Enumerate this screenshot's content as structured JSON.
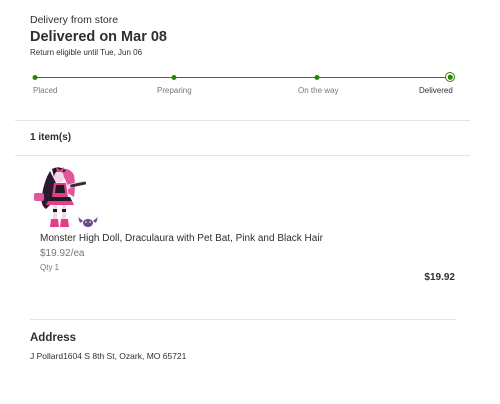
{
  "order": {
    "delivery_method": "Delivery from store",
    "status_title": "Delivered on Mar 08",
    "return_note": "Return eligible until Tue, Jun 06"
  },
  "tracker": {
    "steps": [
      "Placed",
      "Preparing",
      "On the way",
      "Delivered"
    ],
    "current_step": "Delivered",
    "accent_color": "#2a8703"
  },
  "items": {
    "count_label": "1 item(s)",
    "list": [
      {
        "image_icon": "doll-product-image",
        "name": "Monster High Doll, Draculaura with Pet Bat, Pink and Black Hair",
        "unit_price": "$19.92/ea",
        "qty": "Qty 1",
        "total": "$19.92"
      }
    ]
  },
  "address": {
    "heading": "Address",
    "text": "J Pollard1604 S 8th St, Ozark, MO 65721"
  }
}
